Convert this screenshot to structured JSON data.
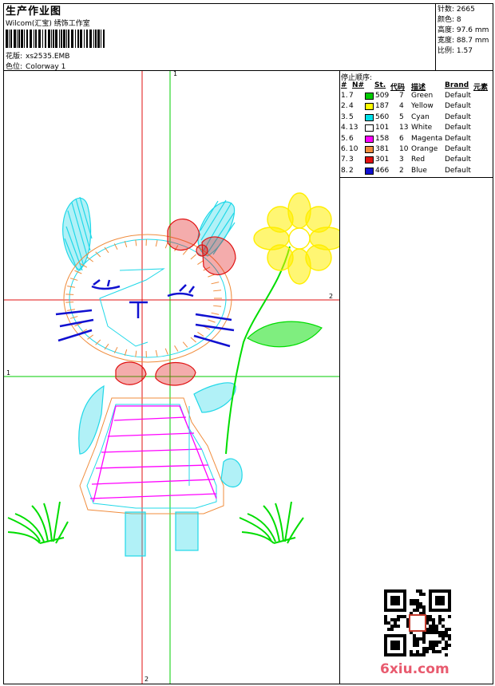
{
  "header": {
    "title": "生产作业图",
    "company": "Wilcom(汇宝) 绣饰工作室",
    "design_label": "花版:",
    "design_value": "xs2535.EMB",
    "colorway_label": "色位:",
    "colorway_value": "Colorway 1"
  },
  "stats": [
    {
      "label": "针数:",
      "value": "2665"
    },
    {
      "label": "颜色:",
      "value": "8"
    },
    {
      "label": "高度:",
      "value": "97.6 mm"
    },
    {
      "label": "宽度:",
      "value": "88.7 mm"
    },
    {
      "label": "比例:",
      "value": "1.57"
    }
  ],
  "color_table": {
    "title": "停止顺序:",
    "headers": {
      "num": "#",
      "needle": "N#",
      "st": "St.",
      "code": "代码",
      "desc": "描述",
      "brand": "Brand",
      "element": "元素"
    },
    "rows": [
      {
        "num": "1.",
        "needle": "7",
        "st": "509",
        "code": "7",
        "desc": "Green",
        "brand": "Default",
        "color": "#00cc00"
      },
      {
        "num": "2.",
        "needle": "4",
        "st": "187",
        "code": "4",
        "desc": "Yellow",
        "brand": "Default",
        "color": "#ffff00"
      },
      {
        "num": "3.",
        "needle": "5",
        "st": "560",
        "code": "5",
        "desc": "Cyan",
        "brand": "Default",
        "color": "#00e0e8"
      },
      {
        "num": "4.",
        "needle": "13",
        "st": "101",
        "code": "13",
        "desc": "White",
        "brand": "Default",
        "color": "#ffffff"
      },
      {
        "num": "5.",
        "needle": "6",
        "st": "158",
        "code": "6",
        "desc": "Magenta",
        "brand": "Default",
        "color": "#ff00ff"
      },
      {
        "num": "6.",
        "needle": "10",
        "st": "381",
        "code": "10",
        "desc": "Orange",
        "brand": "Default",
        "color": "#f08c3c"
      },
      {
        "num": "7.",
        "needle": "3",
        "st": "301",
        "code": "3",
        "desc": "Red",
        "brand": "Default",
        "color": "#e01010"
      },
      {
        "num": "8.",
        "needle": "2",
        "st": "466",
        "code": "2",
        "desc": "Blue",
        "brand": "Default",
        "color": "#1010d0"
      }
    ]
  },
  "axes": {
    "green_vertical_label": "1",
    "green_horizontal_label": "1",
    "red_horizontal_label": "2",
    "red_vertical_label": "2"
  },
  "watermark": {
    "site": "6xiu.com"
  }
}
